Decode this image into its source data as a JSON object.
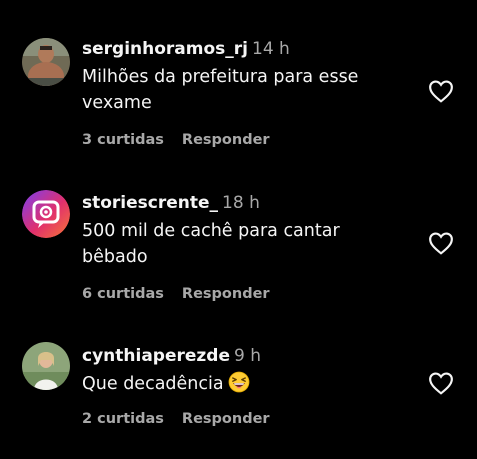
{
  "comments": [
    {
      "username": "serginhoramos_rj",
      "time": "14 h",
      "text": "Milhões da prefeitura para esse vexame",
      "likes": "3 curtidas",
      "reply": "Responder",
      "avatar_icon": "profile-photo-man-shirtless"
    },
    {
      "username": "storiescrente_",
      "time": "18 h",
      "text": "500 mil de cachê para cantar bêbado",
      "likes": "6 curtidas",
      "reply": "Responder",
      "avatar_icon": "stories-logo-gradient"
    },
    {
      "username": "cynthiaperezde",
      "time": "9 h",
      "text": "Que decadência",
      "likes": "2 curtidas",
      "reply": "Responder",
      "avatar_icon": "profile-photo-woman",
      "emoji": "grinning-squinting-face-emoji"
    }
  ],
  "colors": {
    "background": "#000000",
    "primary_text": "#f5f5f5",
    "secondary_text": "#a8a8a8"
  }
}
